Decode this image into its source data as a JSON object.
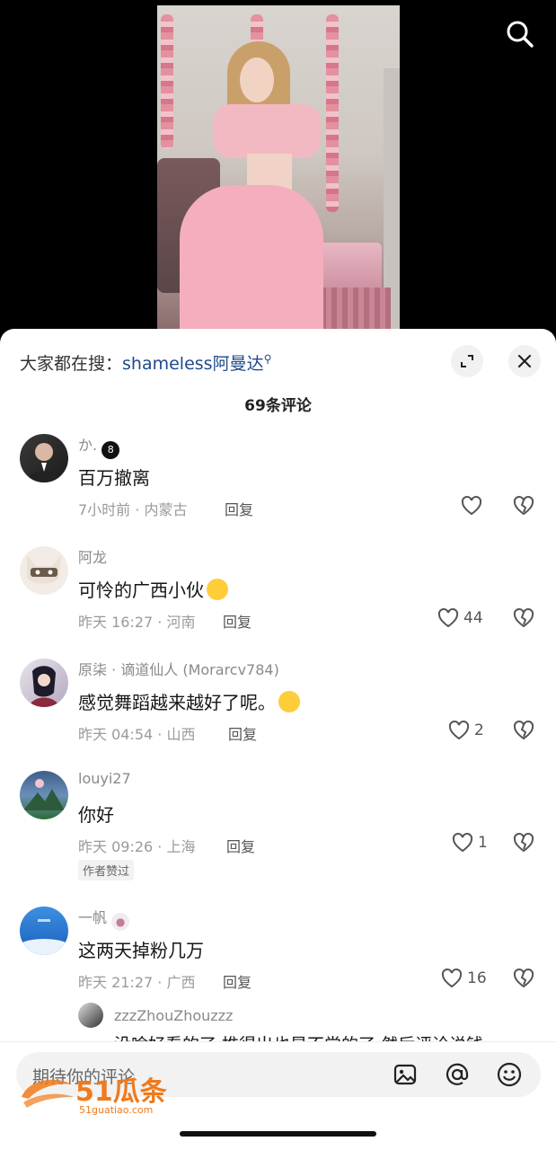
{
  "search_icon": "search-icon",
  "sheet": {
    "hot_search_prefix": "大家都在搜：",
    "hot_search_keyword": "shameless阿曼达",
    "comment_count": "69条评论"
  },
  "comments": [
    {
      "name": "か.",
      "text": "百万撤离",
      "meta": "7小时前 · 内蒙古",
      "reply": "回复",
      "likes": ""
    },
    {
      "name": "阿龙",
      "text": "可怜的广西小伙",
      "meta": "昨天 16:27 · 河南",
      "reply": "回复",
      "likes": "44"
    },
    {
      "name": "原柒 · 谪道仙人 (Morarcv784)",
      "text": "感觉舞蹈越来越好了呢。",
      "meta": "昨天 04:54 · 山西",
      "reply": "回复",
      "likes": "2"
    },
    {
      "name": "louyi27",
      "text": "你好",
      "meta": "昨天 09:26 · 上海",
      "reply": "回复",
      "likes": "1",
      "badge": "作者赞过"
    },
    {
      "name": "一帆",
      "text": "这两天掉粉几万",
      "meta": "昨天 21:27 · 广西",
      "reply": "回复",
      "likes": "16"
    }
  ],
  "sub_reply": {
    "name": "zzzZhouZhouzzz",
    "text_partial": "没啥好看的了 推得出也是不尝的了 然后评论说钱"
  },
  "input": {
    "placeholder": "期待你的评论"
  },
  "watermark": {
    "text": "51瓜条",
    "url": "51guatiao.com"
  },
  "colors": {
    "keyword": "#1e4a8a",
    "watermark": "#f07a1a"
  }
}
